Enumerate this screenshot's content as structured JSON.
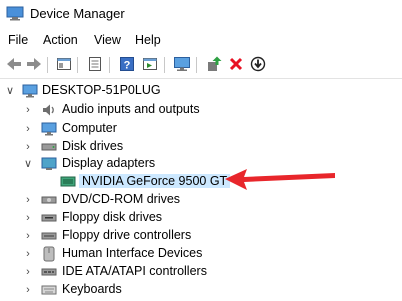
{
  "window": {
    "title": "Device Manager"
  },
  "menu": [
    "File",
    "Action",
    "View",
    "Help"
  ],
  "toolbar": {
    "buttons": [
      "back-icon",
      "forward-icon",
      "properties-icon",
      "update-view-icon",
      "help-icon",
      "console-icon",
      "scan-hardware-icon",
      "add-driver-icon",
      "uninstall-icon",
      "disable-icon"
    ]
  },
  "tree": {
    "root": "DESKTOP-51P0LUG",
    "items": [
      {
        "label": "Audio inputs and outputs",
        "icon": "speaker-icon",
        "expanded": false
      },
      {
        "label": "Computer",
        "icon": "computer-icon",
        "expanded": false
      },
      {
        "label": "Disk drives",
        "icon": "disk-drive-icon",
        "expanded": false
      },
      {
        "label": "Display adapters",
        "icon": "display-adapter-icon",
        "expanded": true
      },
      {
        "label": "NVIDIA GeForce 9500 GT",
        "icon": "gpu-icon",
        "child": true,
        "selected": true
      },
      {
        "label": "DVD/CD-ROM drives",
        "icon": "dvd-icon",
        "expanded": false
      },
      {
        "label": "Floppy disk drives",
        "icon": "floppy-icon",
        "expanded": false
      },
      {
        "label": "Floppy drive controllers",
        "icon": "floppy-controller-icon",
        "expanded": false
      },
      {
        "label": "Human Interface Devices",
        "icon": "hid-icon",
        "expanded": false
      },
      {
        "label": "IDE ATA/ATAPI controllers",
        "icon": "ide-controller-icon",
        "expanded": false
      },
      {
        "label": "Keyboards",
        "icon": "keyboard-icon",
        "expanded": false
      }
    ]
  },
  "colors": {
    "selection": "#cce8ff",
    "arrow": "#e8262b",
    "uninstall": "#e81123",
    "add": "#2ea043"
  }
}
